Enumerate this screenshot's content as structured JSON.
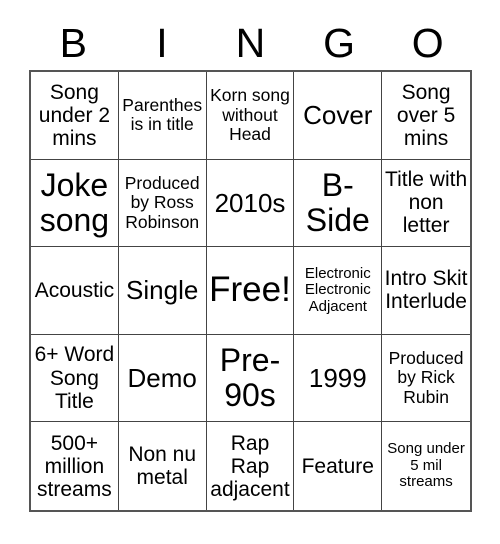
{
  "card": {
    "header_letters": [
      "B",
      "I",
      "N",
      "G",
      "O"
    ],
    "columns": 5,
    "rows": 5,
    "colors": {
      "background": "#ffffff",
      "text": "#000000",
      "grid_line": "#444444",
      "grid_border": "#555555"
    },
    "cells": [
      {
        "text": "Song under 2 mins",
        "size": "m"
      },
      {
        "text": "Parenthesis in title",
        "size": "s"
      },
      {
        "text": "Korn song without Head",
        "size": "s"
      },
      {
        "text": "Cover",
        "size": "l"
      },
      {
        "text": "Song over 5 mins",
        "size": "m"
      },
      {
        "text": "Joke song",
        "size": "xl"
      },
      {
        "text": "Produced by Ross Robinson",
        "size": "s"
      },
      {
        "text": "2010s",
        "size": "l"
      },
      {
        "text": "B-Side",
        "size": "xl"
      },
      {
        "text": "Title with non letter",
        "size": "m"
      },
      {
        "text": "Acoustic",
        "size": "m"
      },
      {
        "text": "Single",
        "size": "l"
      },
      {
        "text": "Free!",
        "size": "xxl"
      },
      {
        "text": "Electronic Electronic Adjacent",
        "size": "xs"
      },
      {
        "text": "Intro Skit Interlude",
        "size": "m"
      },
      {
        "text": "6+ Word Song Title",
        "size": "m"
      },
      {
        "text": "Demo",
        "size": "l"
      },
      {
        "text": "Pre-90s",
        "size": "xl"
      },
      {
        "text": "1999",
        "size": "l"
      },
      {
        "text": "Produced by Rick Rubin",
        "size": "s"
      },
      {
        "text": "500+ million streams",
        "size": "m"
      },
      {
        "text": "Non nu metal",
        "size": "m"
      },
      {
        "text": "Rap Rap adjacent",
        "size": "m"
      },
      {
        "text": "Feature",
        "size": "m"
      },
      {
        "text": "Song under 5 mil streams",
        "size": "xs"
      }
    ]
  }
}
